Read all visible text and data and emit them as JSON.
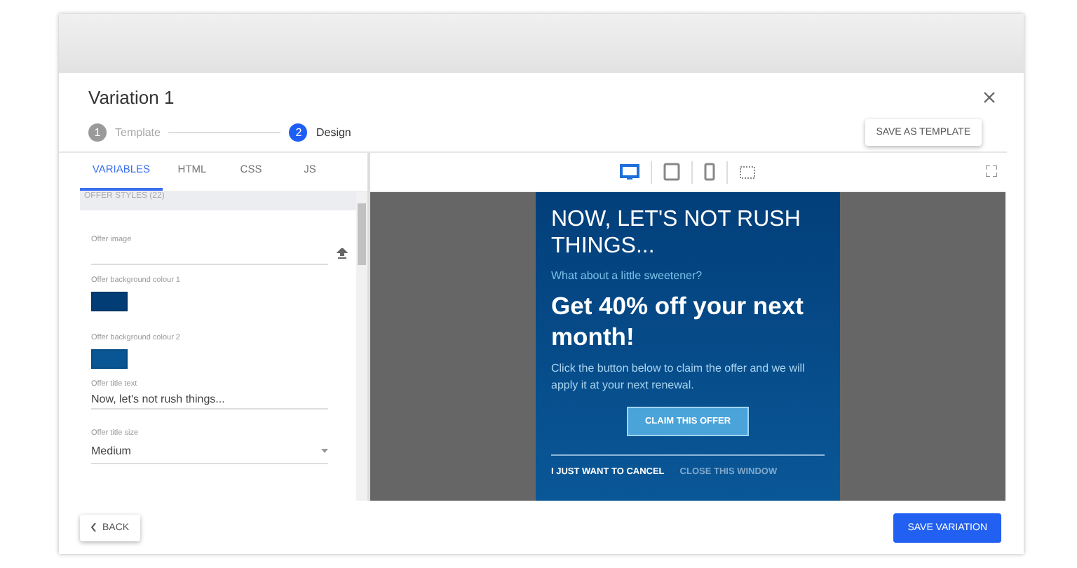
{
  "dialog": {
    "title": "Variation 1"
  },
  "steps": [
    {
      "number": "1",
      "label": "Template",
      "selected": false
    },
    {
      "number": "2",
      "label": "Design",
      "selected": true
    }
  ],
  "save_as_template": "SAVE AS TEMPLATE",
  "tabs": [
    {
      "label": "VARIABLES",
      "selected": true
    },
    {
      "label": "HTML",
      "selected": false
    },
    {
      "label": "CSS",
      "selected": false
    },
    {
      "label": "JS",
      "selected": false
    }
  ],
  "section": {
    "title": "OFFER STYLES (22)"
  },
  "fields": [
    {
      "kind": "image",
      "label": "Offer image"
    },
    {
      "kind": "color",
      "label": "Offer background colour 1",
      "color": "#033d75"
    },
    {
      "kind": "color",
      "label": "Offer background colour 2",
      "color": "#0a5594"
    },
    {
      "kind": "text",
      "label": "Offer title text",
      "value": "Now, let's not rush things..."
    },
    {
      "kind": "select",
      "label": "Offer title size",
      "value": "Medium"
    }
  ],
  "devices": [
    {
      "kind": "desktop",
      "selected": true
    },
    {
      "kind": "tablet",
      "selected": false
    },
    {
      "kind": "phone",
      "selected": false
    },
    {
      "kind": "custom",
      "selected": false
    }
  ],
  "preview": {
    "title": "NOW, LET'S NOT RUSH THINGS...",
    "subtitle": "What about a little sweetener?",
    "headline": "Get 40% off your next month!",
    "body": "Click the button below to claim the offer and we will apply it at your next renewal.",
    "claim": "CLAIM THIS OFFER",
    "cancel": "I JUST WANT TO CANCEL",
    "close": "CLOSE THIS WINDOW"
  },
  "footer": {
    "back": "BACK",
    "save": "SAVE VARIATION"
  }
}
